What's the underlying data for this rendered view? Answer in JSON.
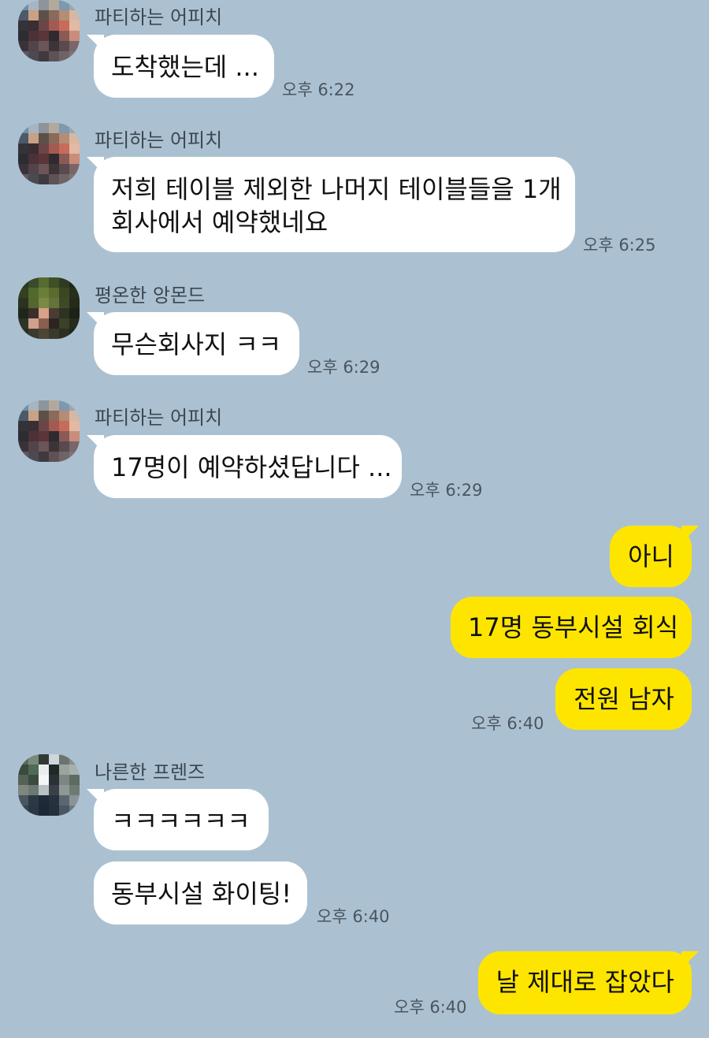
{
  "chat": {
    "m1": {
      "sender": "파티하는 어피치",
      "text": "도착했는데 ...",
      "time": "오후 6:22"
    },
    "m2": {
      "sender": "파티하는 어피치",
      "line1": "저희 테이블 제외한 나머지 테이블들을 1개",
      "line2": "회사에서 예약했네요",
      "time": "오후 6:25"
    },
    "m3": {
      "sender": "평온한 앙몬드",
      "text": "무슨회사지 ㅋㅋ",
      "time": "오후 6:29"
    },
    "m4": {
      "sender": "파티하는 어피치",
      "text": "17명이 예약하셨답니다 ...",
      "time": "오후 6:29"
    },
    "me1": {
      "b1": "아니",
      "b2": "17명 동부시설 회식",
      "b3": "전원 남자",
      "time": "오후 6:40"
    },
    "m5": {
      "sender": "나른한 프렌즈",
      "b1": "ㅋㅋㅋㅋㅋㅋ",
      "b2": "동부시설 화이팅!",
      "time": "오후 6:40"
    },
    "me2": {
      "text": "날 제대로 잡았다",
      "time": "오후 6:40"
    }
  },
  "avatars": {
    "apeach": [
      "#6f8fa9",
      "#a7b4c1",
      "#8d949b",
      "#b3a89c",
      "#7e98ae",
      "#9aa6b2",
      "#4d5a68",
      "#c9a184",
      "#5d5048",
      "#8a6a5a",
      "#b58c74",
      "#d8b7a2",
      "#35333a",
      "#3a2d33",
      "#6b4547",
      "#a45a50",
      "#c76b5a",
      "#e2b9a3",
      "#2c2c33",
      "#4a3238",
      "#5b3537",
      "#2e2a2f",
      "#8c5a55",
      "#c98d7c",
      "#3a3238",
      "#52454a",
      "#6b5558",
      "#3d3438",
      "#5a4a4d",
      "#7a6669",
      "#5d5a5e",
      "#4c4a50",
      "#3e3a40",
      "#5e5255",
      "#6e6467",
      "#7b7477"
    ],
    "almond": [
      "#2a3a1f",
      "#3b4a2a",
      "#556b2f",
      "#3f4f26",
      "#2f3b20",
      "#1e2617",
      "#34401f",
      "#4e6a2c",
      "#6b7d3a",
      "#5a6b2d",
      "#3a4722",
      "#262f1a",
      "#2b3320",
      "#55652d",
      "#7a8a44",
      "#63733a",
      "#3e4a26",
      "#232b19",
      "#1f271a",
      "#3a2f2a",
      "#d9a08a",
      "#4a3b33",
      "#2c3320",
      "#1c2216",
      "#2d3425",
      "#cfa08e",
      "#8a5f50",
      "#2a2520",
      "#3a4128",
      "#262c1c",
      "#2a2f22",
      "#3b3a2e",
      "#4a4536",
      "#3a3a2c",
      "#2c3023",
      "#20251a"
    ],
    "friends": [
      "#5a6a5c",
      "#7a8a7a",
      "#2f3a33",
      "#cfd6dc",
      "#6b7570",
      "#8a9290",
      "#3a4a3e",
      "#4e6b57",
      "#e8ecef",
      "#1f2a27",
      "#9aa4a0",
      "#a8b0ad",
      "#566256",
      "#3d4a3f",
      "#f2f4f6",
      "#2a3236",
      "#7d8782",
      "#5e6b62",
      "#7e867e",
      "#6a7a72",
      "#b8c0c6",
      "#3a4048",
      "#8e9894",
      "#6e7a74",
      "#4a5660",
      "#2c3844",
      "#1e2a38",
      "#26323e",
      "#5a6670",
      "#8a9498",
      "#3a4654",
      "#2a3644",
      "#1c2836",
      "#24303c",
      "#4a5662",
      "#6e7a82"
    ]
  }
}
